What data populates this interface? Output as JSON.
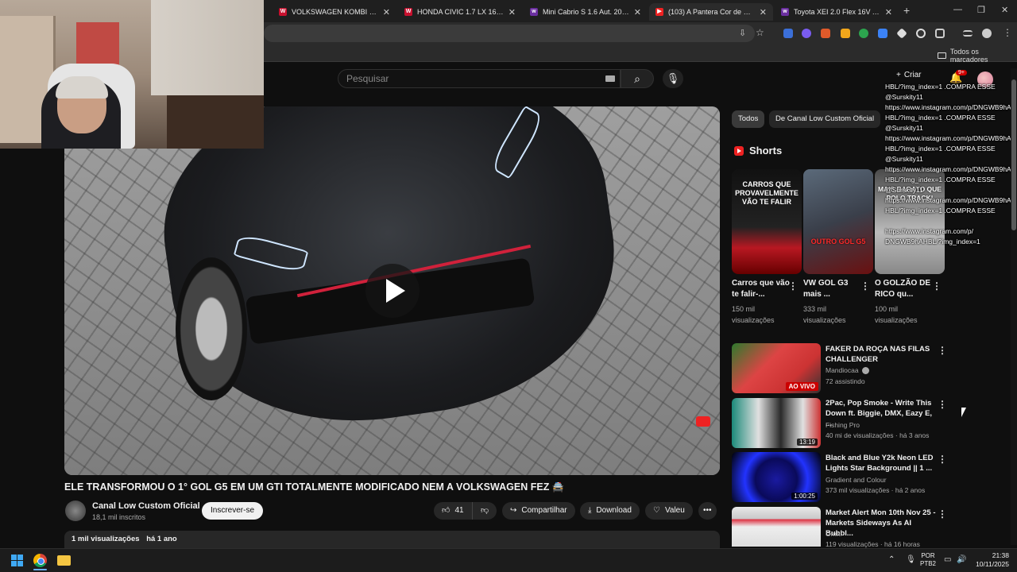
{
  "browser": {
    "tabs": [
      {
        "title": "VOLKSWAGEN KOMBI 1.6 FURG",
        "favicon_color": "#c8102e",
        "favicon_glyph": "W"
      },
      {
        "title": "HONDA CIVIC 1.7 LX 16V GASO",
        "favicon_color": "#c8102e",
        "favicon_glyph": "W"
      },
      {
        "title": "Mini Cabrio S 1.6 Aut. 2010 - T",
        "favicon_color": "#6b2fa0",
        "favicon_glyph": "w"
      },
      {
        "title": "(103) A Pantera Cor de Rosa en",
        "favicon_color": "#e22",
        "favicon_glyph": "▶"
      },
      {
        "title": "Toyota XEI 2.0 Flex 16V Aut. 20",
        "favicon_color": "#6b2fa0",
        "favicon_glyph": "w"
      }
    ],
    "all_bookmarks": "Todos os marcadores"
  },
  "youtube": {
    "search_placeholder": "Pesquisar",
    "create_label": "Criar",
    "notif_count": "9+",
    "video": {
      "title": "ELE TRANSFORMOU O 1° GOL G5 EM UM GTI TOTALMENTE MODIFICADO NEM A VOLKSWAGEN FEZ 🚔",
      "channel": "Canal Low Custom Oficial",
      "subscribers": "18,1 mil inscritos",
      "subscribe_label": "Inscrever-se",
      "likes": "41",
      "share_label": "Compartilhar",
      "download_label": "Download",
      "thanks_label": "Valeu",
      "views": "1 mil visualizações",
      "age": "há 1 ano"
    },
    "chips": [
      "Todos",
      "De Canal Low Custom Oficial"
    ],
    "shorts_label": "Shorts",
    "shorts": [
      {
        "overlay": "CARROS QUE PROVAVELMENTE VÃO TE FALIR",
        "title": "Carros que vão te falir-...",
        "views": "150 mil visualizações"
      },
      {
        "overlay": "OUTRO GOL G5",
        "title": "VW GOL G3 mais ...",
        "views": "333 mil visualizações"
      },
      {
        "overlay": "MAIS BARATO QUE POLO TRACK!",
        "title": "O GOLZÃO DE RICO qu...",
        "views": "100 mil visualizações"
      }
    ],
    "recommendations": [
      {
        "title": "FAKER DA ROÇA NAS FILAS CHALLENGER",
        "channel": "Mandiocaa",
        "verified": true,
        "meta": "72 assistindo",
        "badge": "AO VIVO",
        "badge_type": "live"
      },
      {
        "title": "2Pac, Pop Smoke - Write This Down ft. Biggie, DMX, Eazy E, ...",
        "channel": "Fishing Pro",
        "verified": false,
        "meta": "40 mi de visualizações · há 3 anos",
        "badge": "13:19",
        "badge_type": "duration"
      },
      {
        "title": "Black and Blue Y2k Neon LED Lights Star Background || 1 ...",
        "channel": "Gradient and Colour",
        "verified": false,
        "meta": "373 mil visualizações · há 2 anos",
        "badge": "1:00:25",
        "badge_type": "duration"
      },
      {
        "title": "Market Alert Mon 10th Nov 25 - Markets Sideways As AI Bubbl...",
        "channel": "Omni",
        "verified": false,
        "meta": "119 visualizações · há 16 horas",
        "badge": "",
        "badge_type": "none"
      }
    ],
    "chat_overlay": "HBL/?img_index=1 .COMPRA ESSE\n@Surskity11\nhttps://www.instagram.com/p/DNGWB9hA\nHBL/?img_index=1 .COMPRA ESSE\n@Surskity11\nhttps://www.instagram.com/p/DNGWB9hA\nHBL/?img_index=1 .COMPRA ESSE\n@Surskity11\nhttps://www.instagram.com/p/DNGWB9hA\nHBL/?img_index=1 .COMPRA ESSE\n@Surskity11\nhttps://www.instagram.com/p/DNGWB9hA\nHBL/?img_index=1 .COMPRA ESSE\n\nhttps://www.instagram.com/p/\nDNGWB9hAHBL/?img_index=1"
  },
  "taskbar": {
    "lang_top": "POR",
    "lang_bottom": "PTB2",
    "time": "21:38",
    "date": "10/11/2025"
  },
  "colors": {
    "youtube_red": "#ff0000",
    "live_red": "#cc0000",
    "background": "#0f0f0f"
  }
}
